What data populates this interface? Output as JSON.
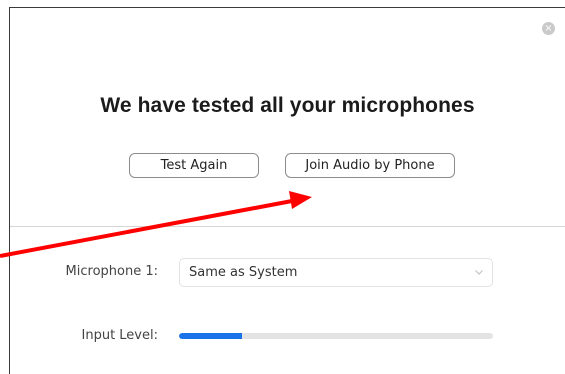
{
  "dialog": {
    "close_icon": "close-icon",
    "close_symbol": "×",
    "title": "We have tested all your microphones"
  },
  "buttons": {
    "test_again_label": "Test Again",
    "join_phone_label": "Join Audio by Phone"
  },
  "settings": {
    "microphone_label": "Microphone 1:",
    "microphone_value": "Same as System",
    "input_level_label": "Input Level:",
    "input_level_fraction": 0.2
  },
  "colors": {
    "level_fill": "#1a73e8",
    "annotation_arrow": "#ff0000"
  }
}
